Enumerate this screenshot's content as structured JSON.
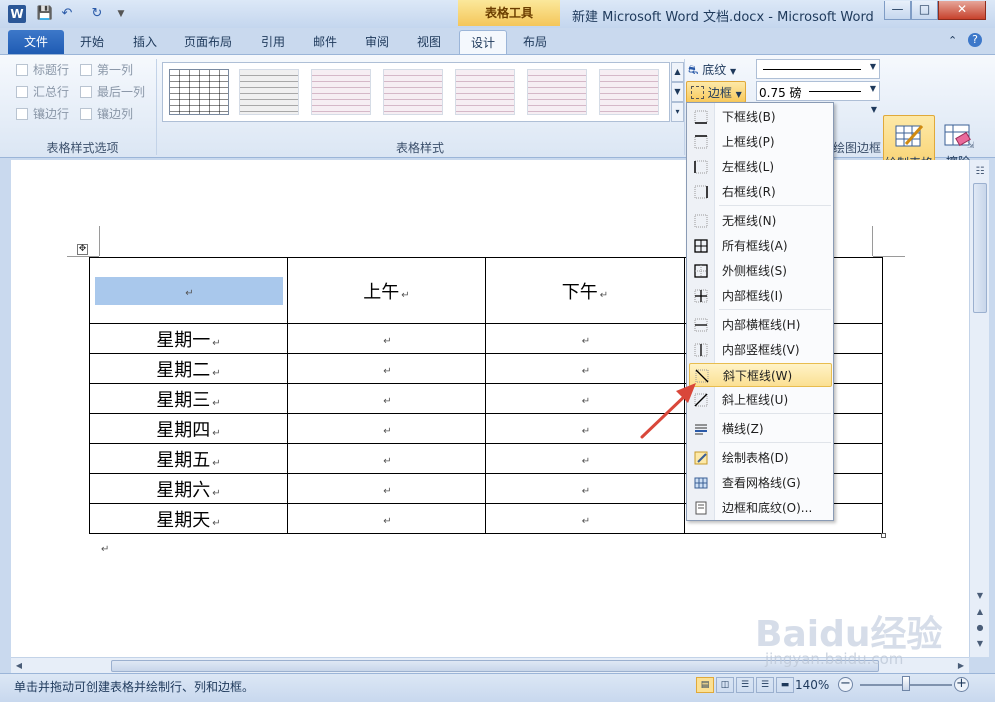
{
  "window": {
    "app_title": "新建 Microsoft Word 文档.docx - Microsoft Word",
    "contextual_tab_group": "表格工具"
  },
  "tabs": [
    "文件",
    "开始",
    "插入",
    "页面布局",
    "引用",
    "邮件",
    "审阅",
    "视图",
    "设计",
    "布局"
  ],
  "active_tab": "设计",
  "ribbon": {
    "style_options": {
      "label": "表格样式选项",
      "items": [
        "标题行",
        "第一列",
        "汇总行",
        "最后一列",
        "镶边行",
        "镶边列"
      ]
    },
    "table_styles": {
      "label": "表格样式"
    },
    "shading_label": "底纹",
    "borders_label": "边框",
    "line_weight": "0.75 磅",
    "draw_borders": {
      "label": "绘图边框",
      "draw_table": "绘制表格",
      "eraser": "擦除"
    }
  },
  "border_menu": [
    {
      "label": "下框线(B)",
      "icon": "bottom-border-icon"
    },
    {
      "label": "上框线(P)",
      "icon": "top-border-icon"
    },
    {
      "label": "左框线(L)",
      "icon": "left-border-icon"
    },
    {
      "label": "右框线(R)",
      "icon": "right-border-icon"
    },
    {
      "label": "无框线(N)",
      "icon": "no-border-icon"
    },
    {
      "label": "所有框线(A)",
      "icon": "all-borders-icon"
    },
    {
      "label": "外侧框线(S)",
      "icon": "outside-borders-icon"
    },
    {
      "label": "内部框线(I)",
      "icon": "inside-borders-icon"
    },
    {
      "label": "内部横框线(H)",
      "icon": "inside-horizontal-border-icon"
    },
    {
      "label": "内部竖框线(V)",
      "icon": "inside-vertical-border-icon"
    },
    {
      "label": "斜下框线(W)",
      "icon": "diagonal-down-border-icon"
    },
    {
      "label": "斜上框线(U)",
      "icon": "diagonal-up-border-icon"
    },
    {
      "label": "横线(Z)",
      "icon": "horizontal-line-icon"
    },
    {
      "label": "绘制表格(D)",
      "icon": "draw-table-icon"
    },
    {
      "label": "查看网格线(G)",
      "icon": "view-gridlines-icon"
    },
    {
      "label": "边框和底纹(O)...",
      "icon": "borders-and-shading-icon"
    }
  ],
  "highlighted_menu_item": "斜下框线(W)",
  "document": {
    "table_header": [
      "",
      "上午",
      "下午"
    ],
    "table_rows": [
      "星期一",
      "星期二",
      "星期三",
      "星期四",
      "星期五",
      "星期六",
      "星期天"
    ],
    "paragraph_mark": "↵"
  },
  "status": {
    "text": "单击并拖动可创建表格并绘制行、列和边框。",
    "zoom": "140%"
  },
  "watermark": {
    "brand": "Baidu经验",
    "url": "jingyan.baidu.com"
  },
  "colors": {
    "accent": "#2b5797",
    "highlight": "#fbe093",
    "cell_selection": "#a9c8ec",
    "arrow": "#d9473a"
  }
}
